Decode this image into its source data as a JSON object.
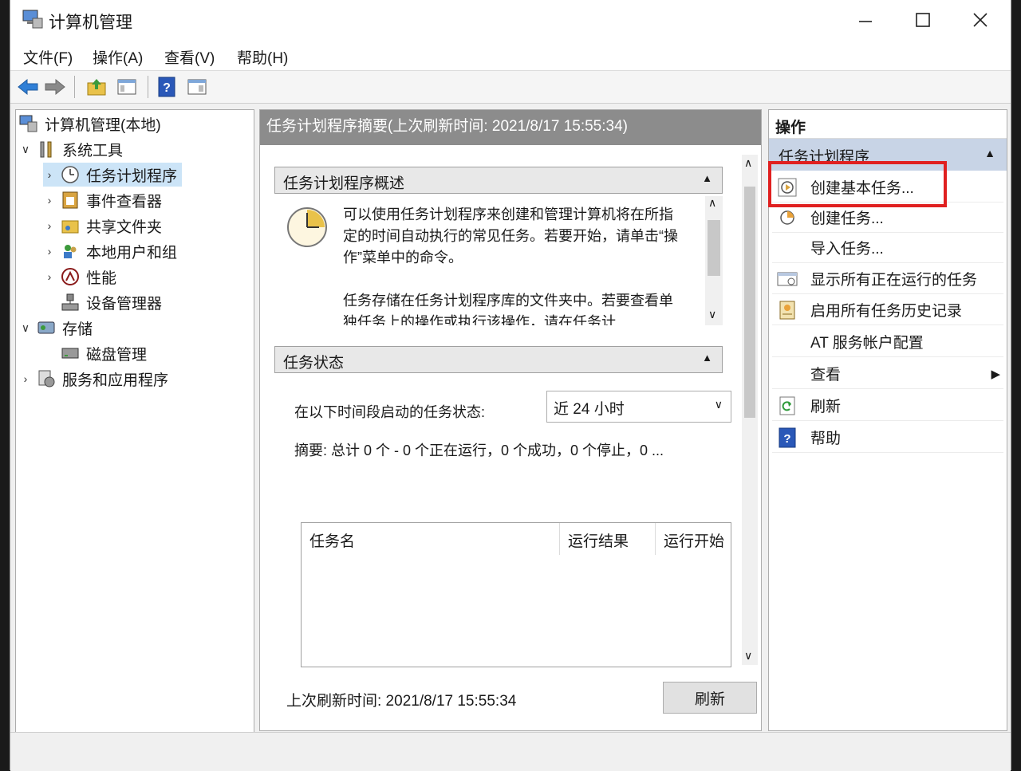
{
  "window": {
    "title": "计算机管理"
  },
  "menu": [
    "文件(F)",
    "操作(A)",
    "查看(V)",
    "帮助(H)"
  ],
  "tree": {
    "root": "计算机管理(本地)",
    "system_tools": "系统工具",
    "task_scheduler": "任务计划程序",
    "event_viewer": "事件查看器",
    "shared_folders": "共享文件夹",
    "local_users": "本地用户和组",
    "performance": "性能",
    "device_manager": "设备管理器",
    "storage": "存储",
    "disk_management": "磁盘管理",
    "services_apps": "服务和应用程序"
  },
  "center": {
    "header": "任务计划程序摘要(上次刷新时间: 2021/8/17 15:55:34)",
    "overview_title": "任务计划程序概述",
    "overview_p1": "可以使用任务计划程序来创建和管理计算机将在所指定的时间自动执行的常见任务。若要开始，请单击“操作”菜单中的命令。",
    "overview_p2": "任务存储在任务计划程序库的文件夹中。若要查看单独任务上的操作或执行该操作，请在任务计",
    "status_title": "任务状态",
    "status_label": "在以下时间段启动的任务状态:",
    "dropdown_value": "近 24 小时",
    "summary": "摘要: 总计 0 个 - 0 个正在运行，0 个成功，0 个停止，0 ...",
    "columns": [
      "任务名",
      "运行结果",
      "运行开始"
    ],
    "last_refresh": "上次刷新时间: 2021/8/17 15:55:34",
    "refresh_button": "刷新"
  },
  "actions": {
    "title": "操作",
    "group": "任务计划程序",
    "items": [
      "创建基本任务...",
      "创建任务...",
      "导入任务...",
      "显示所有正在运行的任务",
      "启用所有任务历史记录",
      "AT 服务帐户配置",
      "查看",
      "刷新",
      "帮助"
    ]
  },
  "colors": {
    "highlight": "#e02020",
    "selection": "#cce4f7",
    "header_gray": "#8c8c8c"
  }
}
